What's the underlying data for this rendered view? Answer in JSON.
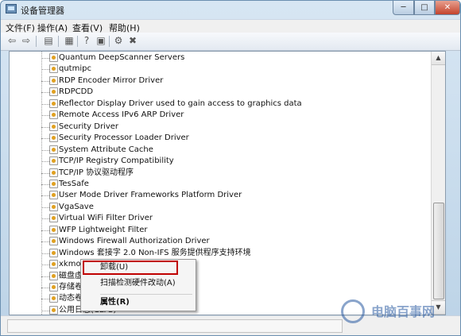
{
  "window": {
    "title": "设备管理器"
  },
  "window_controls": {
    "minimize": "─",
    "maximize": "□",
    "close": "✕"
  },
  "menu": [
    "文件(F)",
    "操作(A)",
    "查看(V)",
    "帮助(H)"
  ],
  "toolbar": [
    {
      "icon": "back-arrow-icon",
      "glyph": "⇦"
    },
    {
      "icon": "forward-arrow-icon",
      "glyph": "⇨"
    },
    {
      "icon": "show-hide-tree-icon",
      "glyph": "▤"
    },
    {
      "icon": "properties-icon",
      "glyph": "▦"
    },
    {
      "icon": "help-icon",
      "glyph": "?"
    },
    {
      "icon": "view-icon",
      "glyph": "▣"
    },
    {
      "icon": "scan-hardware-icon",
      "glyph": "⚙"
    },
    {
      "icon": "uninstall-icon",
      "glyph": "✖"
    }
  ],
  "tree_rows": [
    "Quantum DeepScanner Servers",
    "qutmipc",
    "RDP Encoder Mirror Driver",
    "RDPCDD",
    "Reflector Display Driver used to gain access to graphics data",
    "Remote Access IPv6 ARP Driver",
    "Security Driver",
    "Security Processor Loader Driver",
    "System Attribute Cache",
    "TCP/IP Registry Compatibility",
    "TCP/IP 协议驱动程序",
    "TesSafe",
    "User Mode Driver Frameworks Platform Driver",
    "VgaSave",
    "Virtual WiFi Filter Driver",
    "WFP Lightweight Filter",
    "Windows Firewall Authorization Driver",
    "Windows 套接字 2.0 Non-IFS 服务提供程序支持环境",
    "xkmou",
    "磁盘虚",
    "存储卷",
    "动态卷",
    "公用日志(CLFS)"
  ],
  "context_menu": {
    "uninstall": "卸载(U)",
    "scan": "扫描检测硬件改动(A)",
    "properties": "属性(R)"
  },
  "watermark": "电脑百事网"
}
